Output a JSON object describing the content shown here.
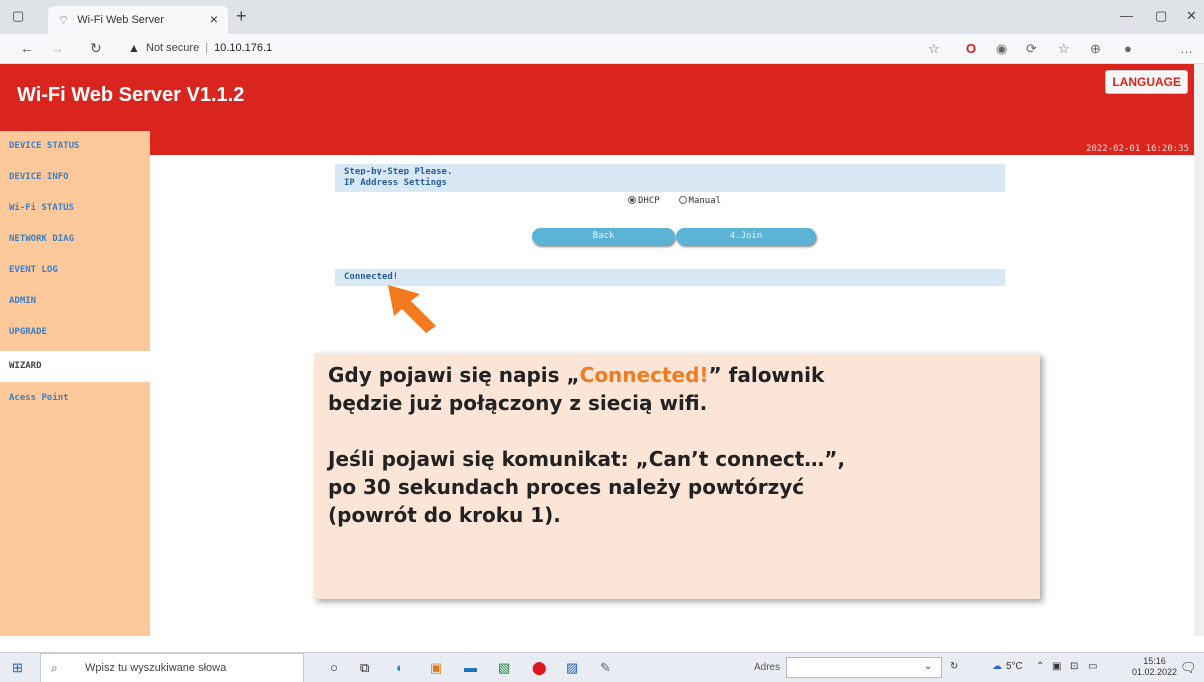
{
  "browser": {
    "tab_title": "Wi-Fi Web Server",
    "not_secure": "Not secure",
    "url": "10.10.176.1"
  },
  "header": {
    "title": "Wi-Fi Web Server V1.1.2",
    "language_button": "LANGUAGE",
    "datetime": "2022-02-01 16:20:35"
  },
  "sidebar": {
    "items": [
      {
        "label": "DEVICE STATUS"
      },
      {
        "label": "DEVICE INFO"
      },
      {
        "label": "Wi-Fi STATUS"
      },
      {
        "label": "NETWORK DIAG"
      },
      {
        "label": "EVENT LOG"
      },
      {
        "label": "ADMIN"
      },
      {
        "label": "UPGRADE"
      },
      {
        "label": "WIZARD"
      },
      {
        "label": "Acess Point"
      }
    ]
  },
  "main": {
    "step_text": "Step-by-Step Please.",
    "ip_settings": "IP Address Settings",
    "dhcp": "DHCP",
    "manual": "Manual",
    "back": "Back",
    "join": "4.Join",
    "status": "Connected!"
  },
  "callout": {
    "l1a": "Gdy pojawi się napis „",
    "l1b": "Connected!",
    "l1c": "” falownik",
    "l2": "będzie już połączony z siecią wifi.",
    "l3": "Jeśli pojawi się komunikat: „Can’t connect…”,",
    "l4": "po 30 sekundach proces należy powtórzyć",
    "l5": "(powrót do kroku 1)."
  },
  "taskbar": {
    "search_placeholder": "Wpisz tu wyszukiwane słowa",
    "adres_label": "Adres",
    "weather": "5°C",
    "time": "15:16",
    "date": "01.02.2022"
  },
  "colors": {
    "header_red": "#d9251d",
    "sidebar_orange": "#fdc99a",
    "button_blue": "#5bb3d6",
    "callout_bg": "#fbe5d6",
    "highlight_orange": "#f47a20"
  }
}
